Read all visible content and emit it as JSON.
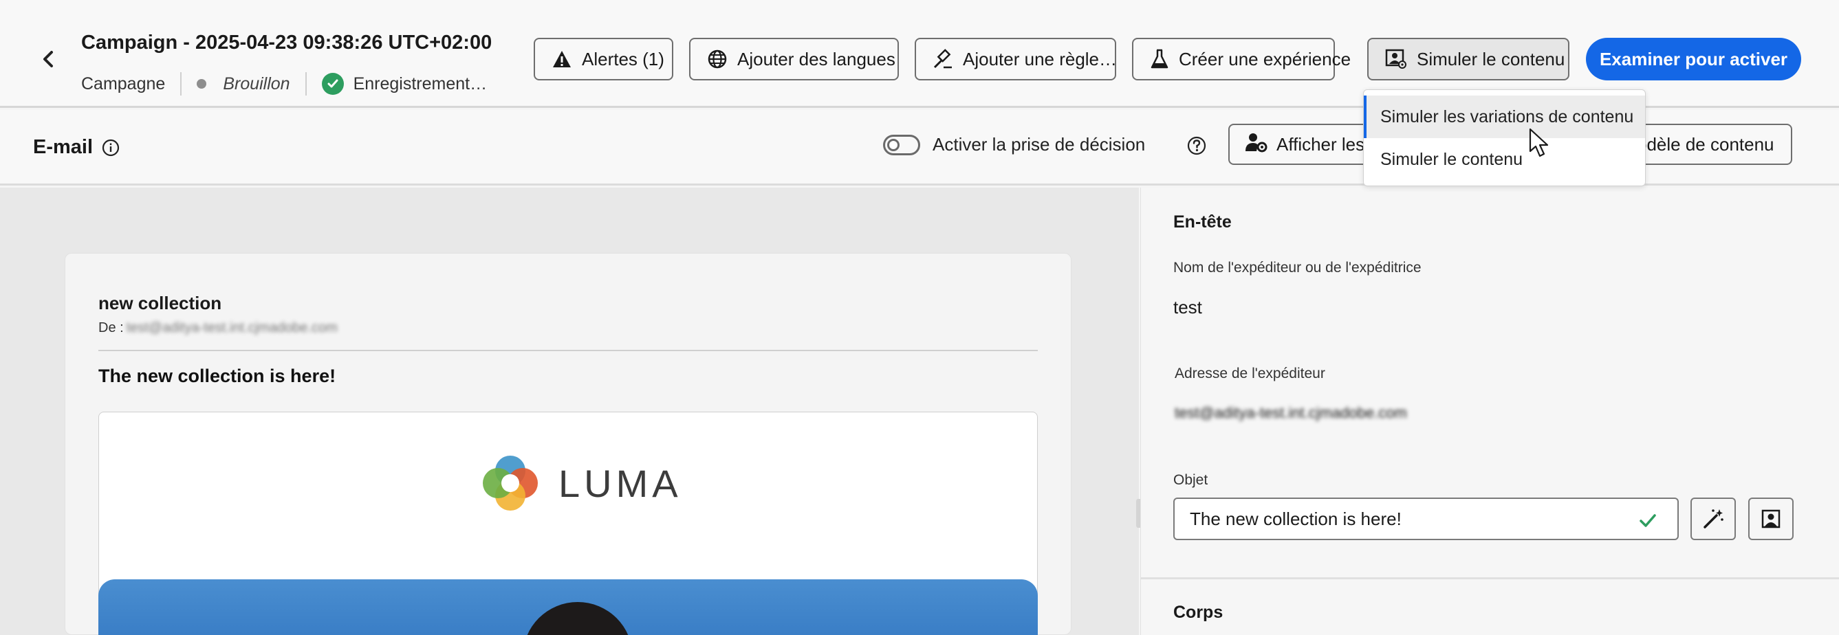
{
  "header": {
    "title": "Campaign - 2025-04-23 09:38:26 UTC+02:00",
    "type": "Campagne",
    "status": "Brouillon",
    "save_status": "Enregistrement…",
    "buttons": {
      "alerts": "Alertes (1)",
      "languages": "Ajouter des langues",
      "rule": "Ajouter une règle…",
      "experiment": "Créer une expérience",
      "simulate": "Simuler le contenu",
      "review": "Examiner pour activer"
    }
  },
  "dropdown": {
    "items": [
      "Simuler les variations de contenu",
      "Simuler le contenu"
    ]
  },
  "subheader": {
    "label": "E-mail",
    "decision_toggle": "Activer la prise de décision",
    "show_button": "Afficher les c",
    "template_button": "odèle de contenu"
  },
  "email": {
    "subject": "new collection",
    "from_label": "De :",
    "from_value": "test@aditya-test.int.cjmadobe.com",
    "preheader": "The new collection is here!",
    "brand": "LUMA"
  },
  "panel": {
    "header_title": "En-tête",
    "sender_name_label": "Nom de l'expéditeur ou de l'expéditrice",
    "sender_name_value": "test",
    "sender_address_label": "Adresse de l'expéditeur",
    "sender_address_value": "test@aditya-test.int.cjmadobe.com",
    "subject_label": "Objet",
    "subject_value": "The new collection is here!",
    "body_title": "Corps"
  },
  "colors": {
    "accent": "#1467e6",
    "success": "#2d9d5f"
  }
}
